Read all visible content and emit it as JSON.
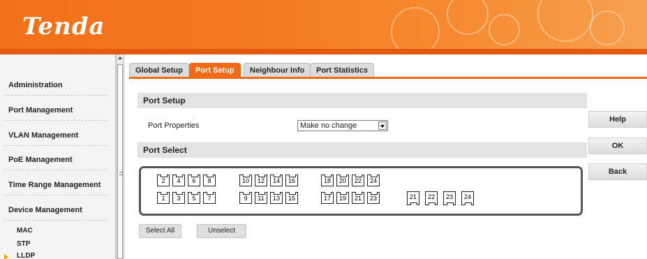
{
  "header": {
    "logo": "Tenda"
  },
  "sidebar": {
    "items": [
      {
        "label": "Administration"
      },
      {
        "label": "Port Management"
      },
      {
        "label": "VLAN Management"
      },
      {
        "label": "PoE Management"
      },
      {
        "label": "Time Range Management"
      },
      {
        "label": "Device Management"
      }
    ],
    "subitems": [
      {
        "label": "MAC"
      },
      {
        "label": "STP"
      },
      {
        "label": "LLDP"
      }
    ]
  },
  "tabs": [
    {
      "label": "Global Setup",
      "active": false
    },
    {
      "label": "Port Setup",
      "active": true
    },
    {
      "label": "Neighbour Info",
      "active": false
    },
    {
      "label": "Port Statistics",
      "active": false
    }
  ],
  "port_setup": {
    "section_title": "Port Setup",
    "properties_label": "Port Properties",
    "properties_value": "Make no change"
  },
  "port_select": {
    "section_title": "Port Select",
    "top_row": [
      "2",
      "4",
      "6",
      "8",
      "10",
      "12",
      "14",
      "16",
      "18",
      "20",
      "22",
      "24"
    ],
    "bottom_row": [
      "1",
      "3",
      "5",
      "7",
      "9",
      "11",
      "13",
      "15",
      "17",
      "19",
      "21",
      "23"
    ],
    "uplink_row": [
      "21",
      "22",
      "23",
      "24"
    ],
    "select_all_label": "Select All",
    "unselect_label": "Unselect"
  },
  "actions": {
    "help_label": "Help",
    "ok_label": "OK",
    "back_label": "Back"
  },
  "colors": {
    "accent": "#f06a1a",
    "header": "#f47a22"
  }
}
